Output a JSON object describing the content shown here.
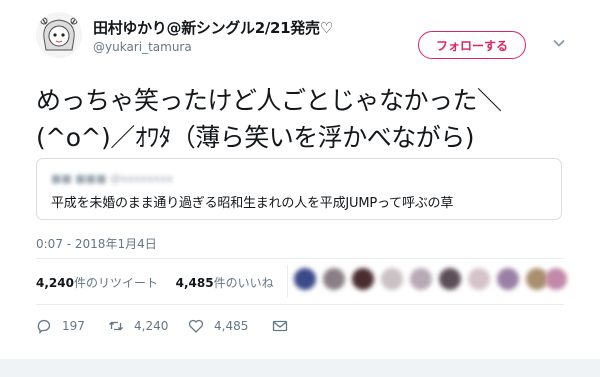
{
  "tweet": {
    "display_name": "田村ゆかり@新シングル2/21発売♡",
    "handle": "@yukari_tamura",
    "follow_label": "フォローする",
    "text": "めっちゃ笑ったけど人ごとじゃなかった＼\n(^o^)／ｵﾜﾀ（薄ら笑いを浮かべながら)",
    "quote": {
      "text": "平成を未婚のまま通り過ぎる昭和生まれの人を平成JUMPって呼ぶの草"
    },
    "timestamp": "0:07 - 2018年1月4日",
    "stats": {
      "retweets_count": "4,240",
      "retweets_label": "件のリツイート",
      "likes_count": "4,485",
      "likes_label": "件のいいね"
    },
    "actions": {
      "reply_count": "197",
      "retweet_count": "4,240",
      "like_count": "4,485"
    }
  },
  "colors": {
    "accent": "#e0245e",
    "secondary_text": "#657786",
    "border": "#e6ecf0"
  },
  "icons": [
    "chevron-down-icon",
    "reply-icon",
    "retweet-icon",
    "like-icon",
    "dm-icon"
  ]
}
